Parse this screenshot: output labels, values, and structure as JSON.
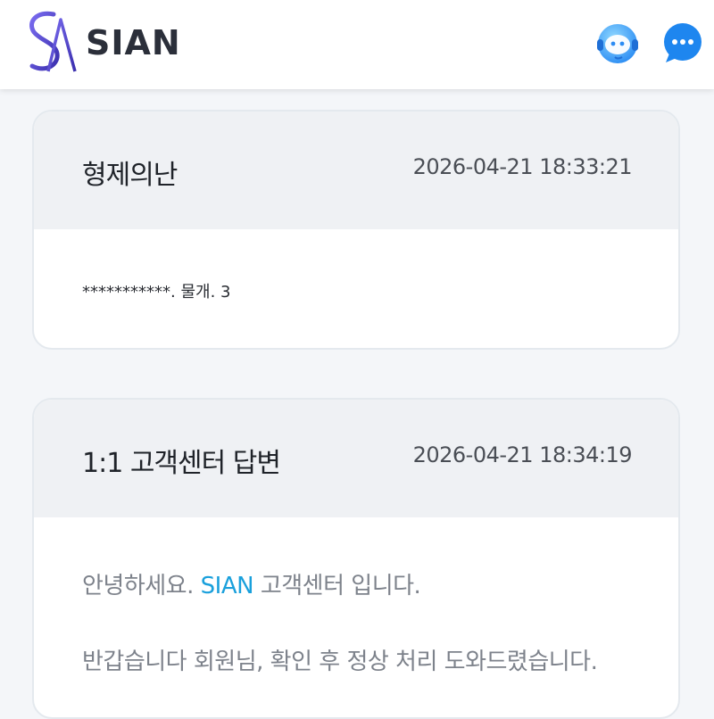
{
  "header": {
    "brand_name": "SIAN",
    "logo_letters": "SA",
    "icons": [
      "support-agent-icon",
      "chat-bubble-icon"
    ],
    "accent_color": "#2b8cf3"
  },
  "messages": [
    {
      "title": "형제의난",
      "timestamp": "2026-04-21 18:33:21",
      "body": "***********. 물개. 3"
    },
    {
      "title": "1:1 고객센터 답변",
      "timestamp": "2026-04-21 18:34:19",
      "line1_before": "안녕하세요. ",
      "line1_brand": "SIAN",
      "line1_after": " 고객센터 입니다.",
      "line2": "반갑습니다 회원님, 확인 후 정상 처리 도와드렸습니다."
    }
  ],
  "colors": {
    "brand_text": "#1aa0dc",
    "reply_text": "#7d828b"
  }
}
